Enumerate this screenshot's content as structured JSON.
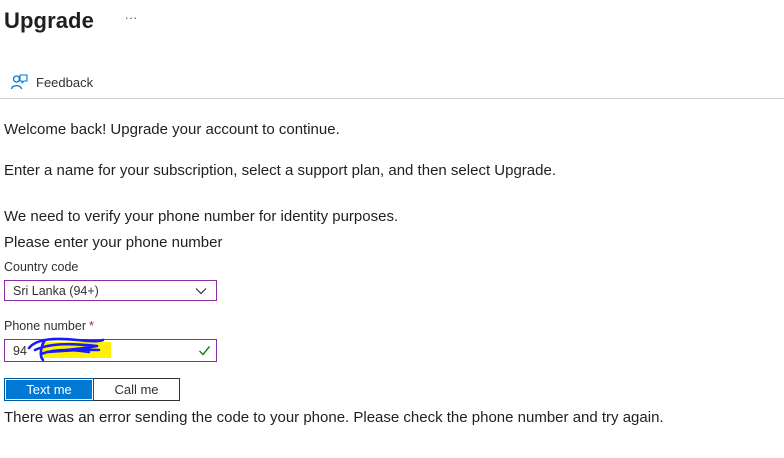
{
  "header": {
    "title": "Upgrade",
    "more_label": "···"
  },
  "toolbar": {
    "feedback_label": "Feedback",
    "feedback_icon": "feedback-person-icon"
  },
  "content": {
    "welcome": "Welcome back! Upgrade your account to continue.",
    "instructions": "Enter a name for your subscription, select a support plan, and then select Upgrade.",
    "verify_intro": "We need to verify your phone number for identity purposes.",
    "phone_prompt": "Please enter your phone number",
    "error_message": "There was an error sending the code to your phone. Please check the phone number and try again."
  },
  "form": {
    "country": {
      "label": "Country code",
      "selected": "Sri Lanka (94+)"
    },
    "phone": {
      "label": "Phone number",
      "required_marker": "*",
      "value": "94",
      "redacted": true
    },
    "buttons": {
      "text_me": "Text me",
      "call_me": "Call me"
    }
  },
  "colors": {
    "accent": "#0078d4",
    "focus_border": "#8a2da5",
    "required": "#a4262c",
    "valid": "#107c10",
    "redaction_highlight": "#fff200",
    "redaction_ink": "#1a1aff"
  }
}
